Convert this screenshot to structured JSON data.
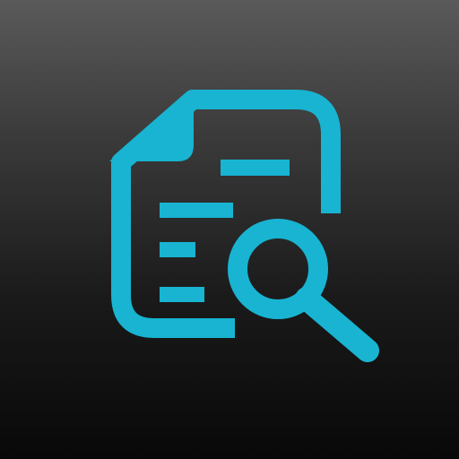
{
  "icon": {
    "semantic": "document-search-icon",
    "accent_color": "#18b4d2",
    "background_top": "#5a5a5a",
    "background_bottom": "#080808"
  }
}
